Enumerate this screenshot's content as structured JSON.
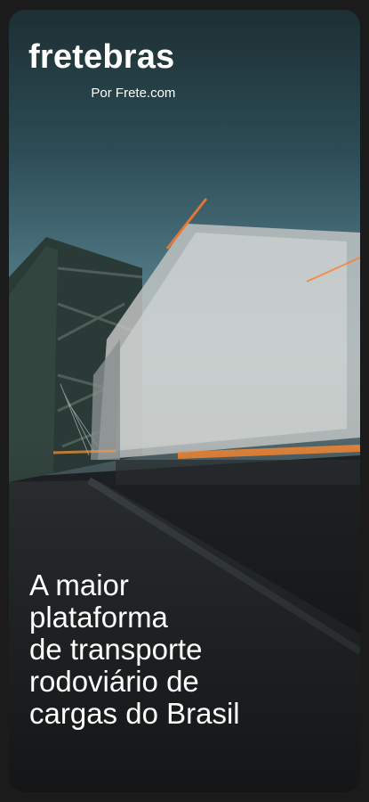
{
  "brand": {
    "name": "fretebras",
    "subtitle": "Por Frete.com"
  },
  "headline": {
    "lines": [
      "A maior",
      "plataforma",
      "de transporte",
      "rodoviário de",
      "cargas do Brasil"
    ]
  },
  "hero_image": {
    "description_icon": "truck-on-bridge-photo"
  },
  "colors": {
    "text": "#ffffff",
    "page_background": "#1b1b1b",
    "light_streak": "#ff7a2a"
  }
}
